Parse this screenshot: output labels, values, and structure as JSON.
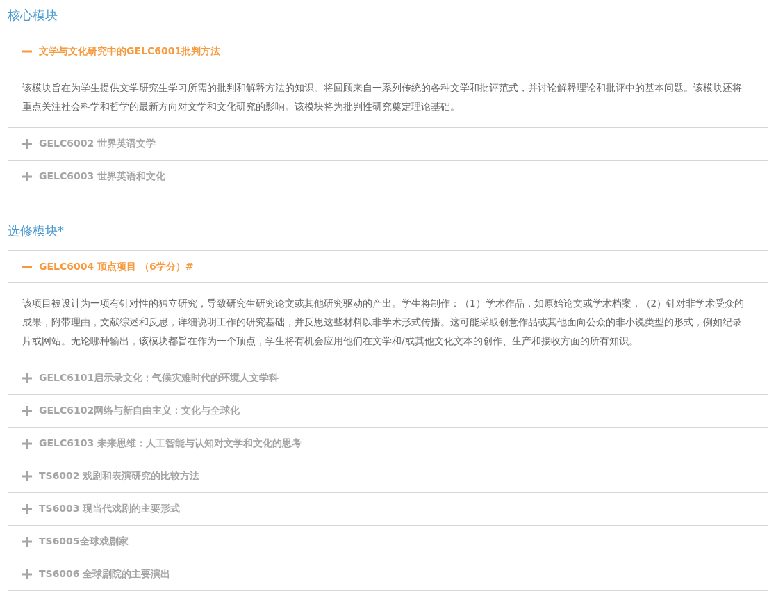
{
  "sections": [
    {
      "title": "核心模块",
      "modules": [
        {
          "title": "文学与文化研究中的GELC6001批判方法",
          "expanded": true,
          "description": "该模块旨在为学生提供文学研究生学习所需的批判和解释方法的知识。将回顾来自一系列传统的各种文学和批评范式，并讨论解释理论和批评中的基本问题。该模块还将重点关注社会科学和哲学的最新方向对文学和文化研究的影响。该模块将为批判性研究奠定理论基础。"
        },
        {
          "title": "GELC6002 世界英语文学",
          "expanded": false
        },
        {
          "title": "GELC6003 世界英语和文化",
          "expanded": false
        }
      ]
    },
    {
      "title": "选修模块*",
      "modules": [
        {
          "title": "GELC6004 顶点项目 （6学分）#",
          "expanded": true,
          "description": "该项目被设计为一项有针对性的独立研究，导致研究生研究论文或其他研究驱动的产出。学生将制作：（1）学术作品，如原始论文或学术档案，（2）针对非学术受众的成果，附带理由，文献综述和反思，详细说明工作的研究基础，并反思这些材料以非学术形式传播。这可能采取创意作品或其他面向公众的非小说类型的形式，例如纪录片或网站。无论哪种输出，该模块都旨在作为一个顶点，学生将有机会应用他们在文学和/或其他文化文本的创作、生产和接收方面的所有知识。"
        },
        {
          "title": "GELC6101启示录文化：气候灾难时代的环境人文学科",
          "expanded": false
        },
        {
          "title": "GELC6102网络与新自由主义：文化与全球化",
          "expanded": false
        },
        {
          "title": "GELC6103 未来思维：人工智能与认知对文学和文化的思考",
          "expanded": false
        },
        {
          "title": "TS6002 戏剧和表演研究的比较方法",
          "expanded": false
        },
        {
          "title": "TS6003 现当代戏剧的主要形式",
          "expanded": false
        },
        {
          "title": "TS6005全球戏剧家",
          "expanded": false
        },
        {
          "title": "TS6006 全球剧院的主要演出",
          "expanded": false
        }
      ]
    }
  ]
}
